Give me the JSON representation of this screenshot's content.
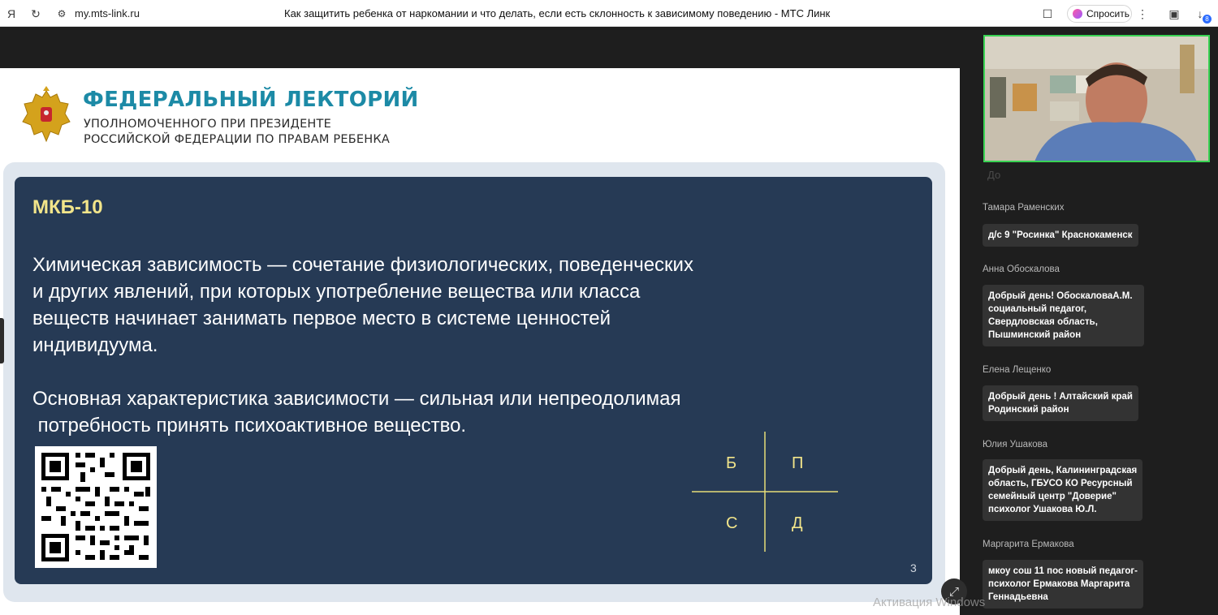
{
  "browser": {
    "yandex_icon": "Я",
    "reload_icon": "↻",
    "site_icon": "⚙",
    "url": "my.mts-link.ru",
    "title": "Как защитить ребенка от наркомании и что делать, если есть склонность к зависимому поведению - МТС Линк",
    "bookmark_icon": "☐",
    "ask_label": "Спросить",
    "menu_icon": "⋮",
    "collections_icon": "▣",
    "downloads_icon": "↓",
    "downloads_badge": "8"
  },
  "slide": {
    "org_title": "ФЕДЕРАЛЬНЫЙ ЛЕКТОРИЙ",
    "org_sub_1": "УПОЛНОМОЧЕННОГО ПРИ ПРЕЗИДЕНТЕ",
    "org_sub_2": "РОССИЙСКОЙ ФЕДЕРАЦИИ ПО ПРАВАМ РЕБЕНКА",
    "heading": "МКБ-10",
    "paragraph_1": "Химическая зависимость — сочетание физиологических, поведенческих\nи других явлений, при которых употребление вещества или класса\nвеществ начинает занимать первое место в системе ценностей\nиндивидуума.",
    "paragraph_2": "Основная характеристика зависимости — сильная или непреодолимая\n потребность принять психоактивное вещество.",
    "grid_labels": [
      "Б",
      "П",
      "С",
      "Д"
    ],
    "page_number": "3"
  },
  "chat": {
    "faded": "До",
    "messages": [
      {
        "name": "Тамара Раменских",
        "text": "д/с 9 \"Росинка\" Краснокаменск"
      },
      {
        "name": "Анна Обоскалова",
        "text": "Добрый день! ОбоскаловаА.М.\nсоциальный педагог,\nСвердловская область,\nПышминский район"
      },
      {
        "name": "Елена Лещенко",
        "text": "Добрый день ! Алтайский край\nРодинский район"
      },
      {
        "name": "Юлия Ушакова",
        "text": "Добрый день, Калининградская\nобласть, ГБУСО КО Ресурсный\nсемейный центр \"Доверие\"\nпсихолог Ушакова Ю.Л."
      },
      {
        "name": "Маргарита Ермакова",
        "text": "мкоу сош 11 пос новый педагог-\nпсихолог Ермакова Маргарита\nГеннадьевна"
      }
    ]
  },
  "expand_icon": "⤢",
  "watermark": "Активация Windows"
}
